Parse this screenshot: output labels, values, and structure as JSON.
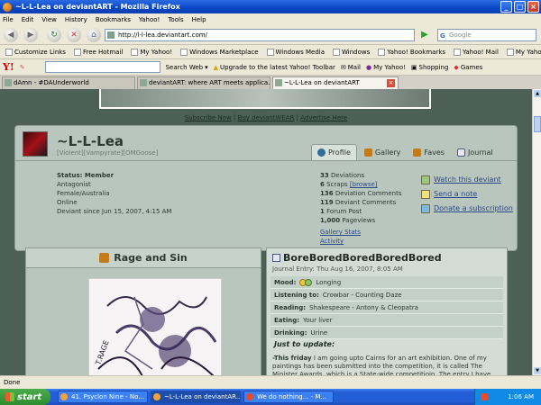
{
  "window": {
    "title": "~L-L-Lea on deviantART - Mozilla Firefox"
  },
  "menu": [
    "File",
    "Edit",
    "View",
    "History",
    "Bookmarks",
    "Yahoo!",
    "Tools",
    "Help"
  ],
  "nav": {
    "url": "http://l-l-lea.deviantart.com/",
    "search_placeholder": "Google"
  },
  "bookmarks": [
    "Customize Links",
    "Free Hotmail",
    "My Yahoo!",
    "Windows Marketplace",
    "Windows Media",
    "Windows",
    "Yahoo! Bookmarks",
    "Yahoo! Mail",
    "My Yahoo!"
  ],
  "yahoo_toolbar": {
    "search_btn": "Search Web",
    "upgrade": "Upgrade to the latest Yahoo! Toolbar",
    "mail": "Mail",
    "my_yahoo": "My Yahoo!",
    "shopping": "Shopping",
    "games": "Games"
  },
  "tabs": [
    {
      "label": "dAmn - #DAUnderworld"
    },
    {
      "label": "deviantART: where ART meets applica..."
    },
    {
      "label": "~L-L-Lea on deviantART"
    }
  ],
  "page": {
    "sublinks": [
      "Subscribe Now",
      "Buy deviantWEAR",
      "Advertise Here"
    ],
    "username": "~L-L-Lea",
    "groups": "[Violent][Vampyrate][OMGoose]",
    "profile_tabs": [
      "Profile",
      "Gallery",
      "Faves",
      "Journal"
    ],
    "status_label": "Status: Member",
    "info": [
      "Antagonist",
      "Female/Australia",
      "Online",
      "Deviant since Jun 15, 2007, 4:15 AM"
    ],
    "stats": [
      {
        "n": "33",
        "label": "Deviations"
      },
      {
        "n": "6",
        "label": "Scraps",
        "link": "[browse]"
      },
      {
        "n": "136",
        "label": "Deviation Comments"
      },
      {
        "n": "119",
        "label": "Deviant Comments"
      },
      {
        "n": "1",
        "label": "Forum Post"
      },
      {
        "n": "1,000",
        "label": "Pageviews"
      }
    ],
    "stat_links": [
      "Gallery Stats",
      "Activity"
    ],
    "actions": [
      "Watch this deviant",
      "Send a note",
      "Donate a subscription"
    ],
    "featured_title": "Rage and Sin",
    "journal": {
      "title": "BoreBoredBoredBoredBored",
      "date": "Journal Entry: Thu Aug 16, 2007, 8:05 AM",
      "mood_label": "Mood:",
      "mood": "Longing",
      "listening_label": "Listening to:",
      "listening": "Crowbar - Counting Daze",
      "reading_label": "Reading:",
      "reading": "Shakespeare - Antony & Cleopatra",
      "eating_label": "Eating:",
      "eating": "Your liver",
      "drinking_label": "Drinking:",
      "drinking": "Urine",
      "update_heading": "Just to update:",
      "body_bold": "-This friday",
      "body": "I am going upto Cairns for an art exhibition. One of my paintings has been submitted into the competition, it is called The Minister Awards, which is a State-wide competitioin. The entry I have"
    }
  },
  "statusbar": {
    "text": "Done"
  },
  "taskbar": {
    "start": "start",
    "tasks": [
      "41. Psyclon Nine - No...",
      "~L-L-Lea on deviantAR...",
      "We do nothing... - M..."
    ],
    "clock": "1:06 AM"
  }
}
